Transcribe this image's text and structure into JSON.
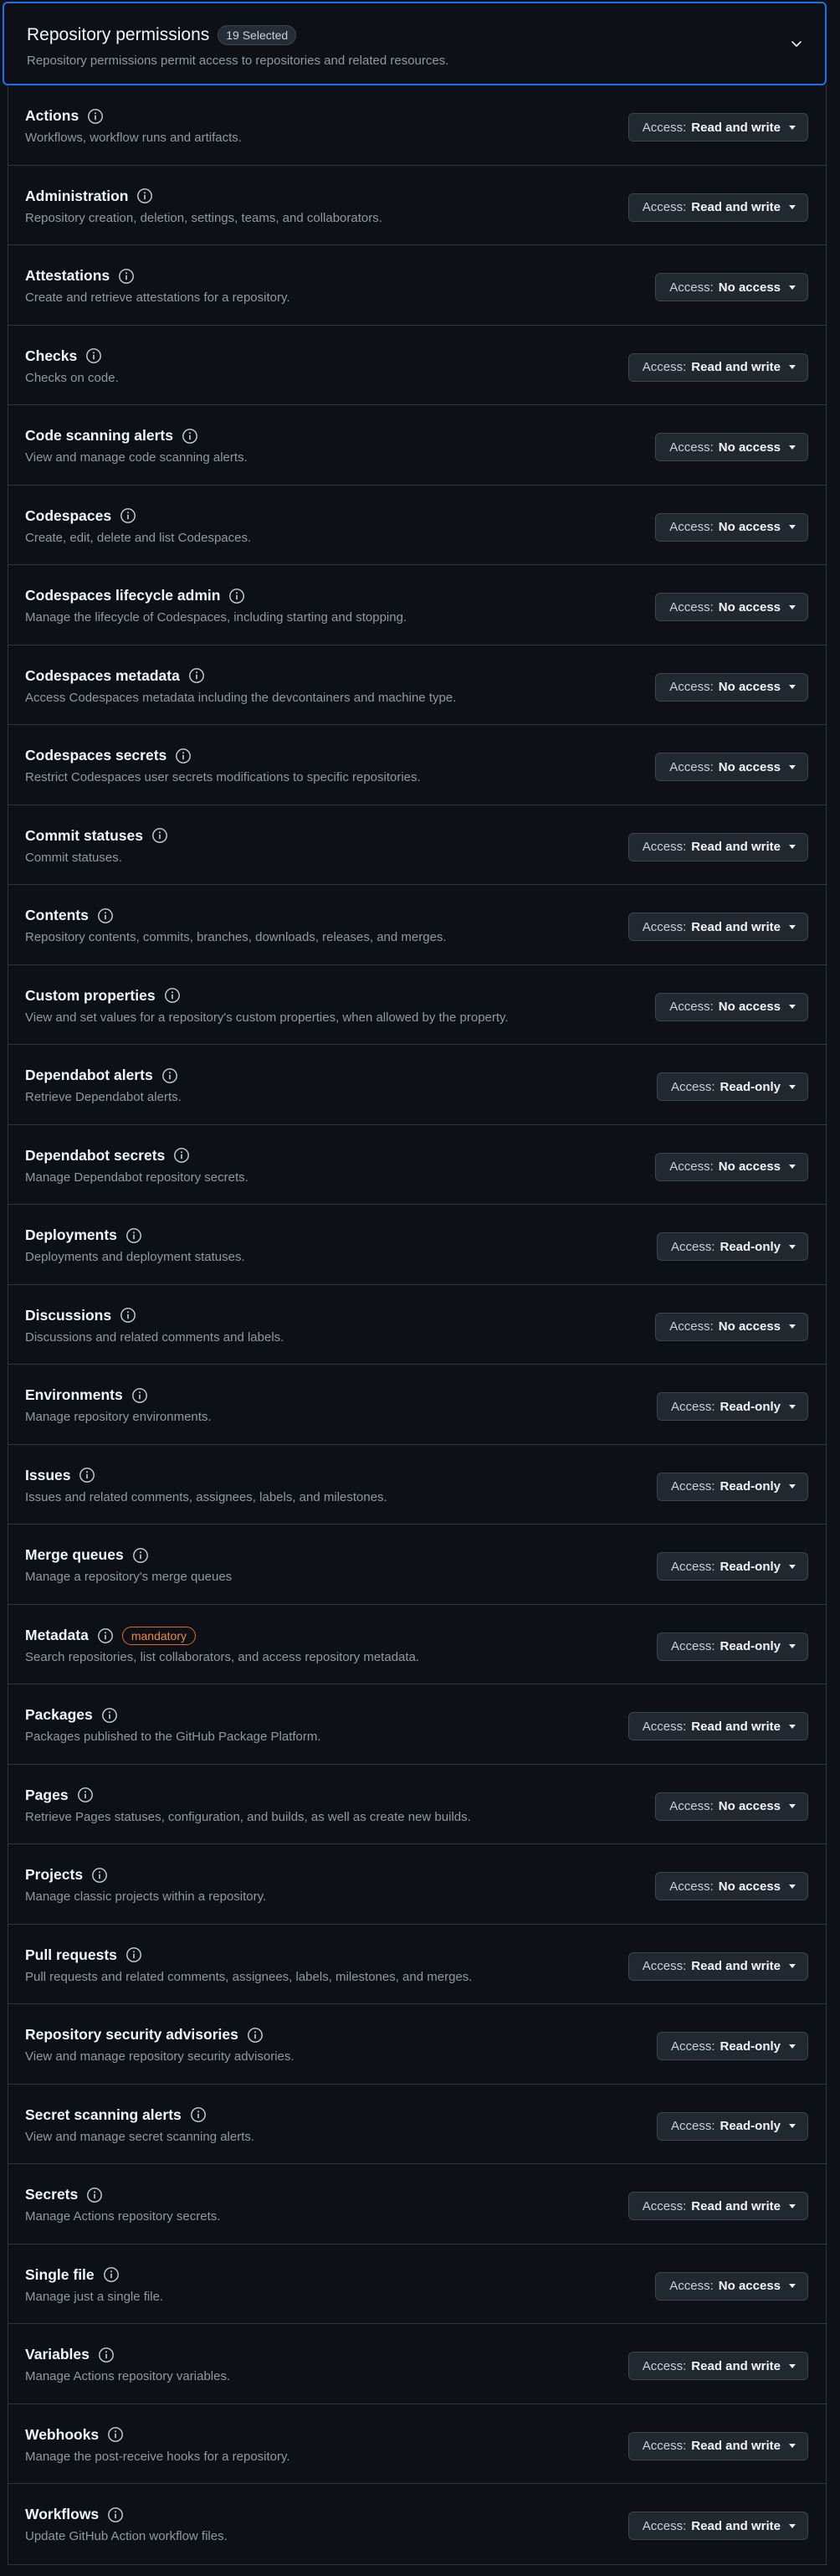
{
  "header": {
    "title": "Repository permissions",
    "count_label": "19 Selected",
    "description": "Repository permissions permit access to repositories and related resources."
  },
  "access_prefix": "Access:",
  "permissions": [
    {
      "name": "Actions",
      "description": "Workflows, workflow runs and artifacts.",
      "access": "Read and write"
    },
    {
      "name": "Administration",
      "description": "Repository creation, deletion, settings, teams, and collaborators.",
      "access": "Read and write"
    },
    {
      "name": "Attestations",
      "description": "Create and retrieve attestations for a repository.",
      "access": "No access"
    },
    {
      "name": "Checks",
      "description": "Checks on code.",
      "access": "Read and write"
    },
    {
      "name": "Code scanning alerts",
      "description": "View and manage code scanning alerts.",
      "access": "No access"
    },
    {
      "name": "Codespaces",
      "description": "Create, edit, delete and list Codespaces.",
      "access": "No access"
    },
    {
      "name": "Codespaces lifecycle admin",
      "description": "Manage the lifecycle of Codespaces, including starting and stopping.",
      "access": "No access"
    },
    {
      "name": "Codespaces metadata",
      "description": "Access Codespaces metadata including the devcontainers and machine type.",
      "access": "No access"
    },
    {
      "name": "Codespaces secrets",
      "description": "Restrict Codespaces user secrets modifications to specific repositories.",
      "access": "No access"
    },
    {
      "name": "Commit statuses",
      "description": "Commit statuses.",
      "access": "Read and write"
    },
    {
      "name": "Contents",
      "description": "Repository contents, commits, branches, downloads, releases, and merges.",
      "access": "Read and write"
    },
    {
      "name": "Custom properties",
      "description": "View and set values for a repository's custom properties, when allowed by the property.",
      "access": "No access"
    },
    {
      "name": "Dependabot alerts",
      "description": "Retrieve Dependabot alerts.",
      "access": "Read-only"
    },
    {
      "name": "Dependabot secrets",
      "description": "Manage Dependabot repository secrets.",
      "access": "No access"
    },
    {
      "name": "Deployments",
      "description": "Deployments and deployment statuses.",
      "access": "Read-only"
    },
    {
      "name": "Discussions",
      "description": "Discussions and related comments and labels.",
      "access": "No access"
    },
    {
      "name": "Environments",
      "description": "Manage repository environments.",
      "access": "Read-only"
    },
    {
      "name": "Issues",
      "description": "Issues and related comments, assignees, labels, and milestones.",
      "access": "Read-only"
    },
    {
      "name": "Merge queues",
      "description": "Manage a repository's merge queues",
      "access": "Read-only"
    },
    {
      "name": "Metadata",
      "description": "Search repositories, list collaborators, and access repository metadata.",
      "access": "Read-only",
      "badge": "mandatory"
    },
    {
      "name": "Packages",
      "description": "Packages published to the GitHub Package Platform.",
      "access": "Read and write"
    },
    {
      "name": "Pages",
      "description": "Retrieve Pages statuses, configuration, and builds, as well as create new builds.",
      "access": "No access"
    },
    {
      "name": "Projects",
      "description": "Manage classic projects within a repository.",
      "access": "No access"
    },
    {
      "name": "Pull requests",
      "description": "Pull requests and related comments, assignees, labels, milestones, and merges.",
      "access": "Read and write"
    },
    {
      "name": "Repository security advisories",
      "description": "View and manage repository security advisories.",
      "access": "Read-only"
    },
    {
      "name": "Secret scanning alerts",
      "description": "View and manage secret scanning alerts.",
      "access": "Read-only"
    },
    {
      "name": "Secrets",
      "description": "Manage Actions repository secrets.",
      "access": "Read and write"
    },
    {
      "name": "Single file",
      "description": "Manage just a single file.",
      "access": "No access"
    },
    {
      "name": "Variables",
      "description": "Manage Actions repository variables.",
      "access": "Read and write"
    },
    {
      "name": "Webhooks",
      "description": "Manage the post-receive hooks for a repository.",
      "access": "Read and write"
    },
    {
      "name": "Workflows",
      "description": "Update GitHub Action workflow files.",
      "access": "Read and write"
    }
  ]
}
